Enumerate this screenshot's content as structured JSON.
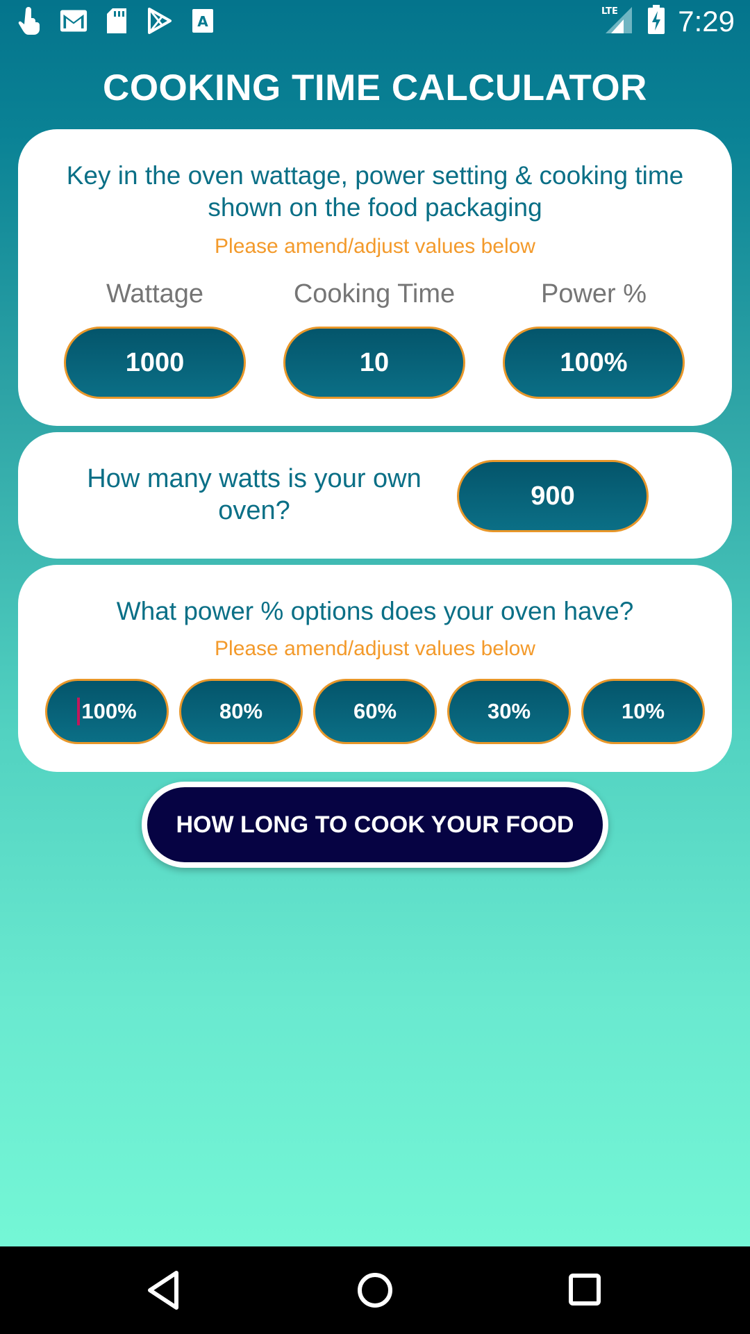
{
  "status_bar": {
    "time": "7:29",
    "network": "LTE",
    "icons_left": [
      "touch-icon",
      "gmail-icon",
      "sd-card-icon",
      "play-store-icon",
      "font-app-icon"
    ],
    "icons_right": [
      "lte-signal-icon",
      "battery-charging-icon"
    ]
  },
  "app": {
    "title": "COOKING TIME CALCULATOR"
  },
  "packaging_card": {
    "heading": "Key in the oven wattage, power setting & cooking time shown on the food packaging",
    "hint": "Please amend/adjust values below",
    "columns": [
      {
        "label": "Wattage",
        "value": "1000"
      },
      {
        "label": "Cooking Time",
        "value": "10"
      },
      {
        "label": "Power %",
        "value": "100%"
      }
    ]
  },
  "own_oven_card": {
    "question": "How many watts is your own oven?",
    "value": "900"
  },
  "power_options_card": {
    "heading": "What power % options does your oven have?",
    "hint": "Please amend/adjust values below",
    "options": [
      "100%",
      "80%",
      "60%",
      "30%",
      "10%"
    ]
  },
  "cta": {
    "label": "HOW LONG TO COOK YOUR FOOD"
  },
  "colors": {
    "accent_orange": "#f39a2b",
    "pill_teal": "#0b6f86",
    "cta_navy": "#060343",
    "heading_teal": "#0a6f86"
  },
  "nav_bar": {
    "buttons": [
      "back-icon",
      "home-icon",
      "recents-icon"
    ]
  }
}
